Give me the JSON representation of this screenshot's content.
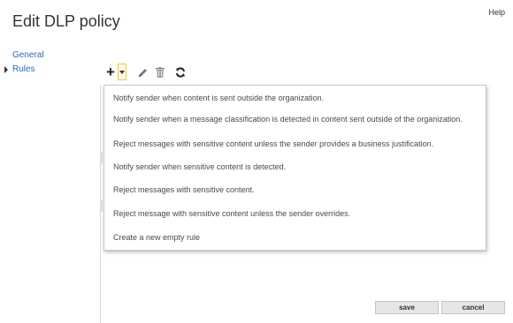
{
  "window": {
    "title": "Edit DLP policy",
    "help_label": "Help"
  },
  "nav": {
    "items": [
      {
        "label": "General"
      },
      {
        "label": "Rules"
      }
    ]
  },
  "toolbar": {
    "add_label": "+",
    "icons": [
      "add-icon",
      "dropdown-arrow-icon",
      "pencil-icon",
      "trash-icon",
      "refresh-icon"
    ]
  },
  "menu": {
    "items": [
      {
        "label": "Notify sender when content is sent outside the organization."
      },
      {
        "label": "Notify sender when a message classification is detected in content sent outside of the organization."
      },
      {
        "label": "Reject messages with sensitive content unless the sender provides a business justification."
      },
      {
        "label": "Notify sender when sensitive content is detected."
      },
      {
        "label": "Reject messages with sensitive content."
      },
      {
        "label": "Reject message with sensitive content unless the sender overrides."
      },
      {
        "label": "Create a new empty rule"
      }
    ]
  },
  "footer": {
    "save_label": "save",
    "cancel_label": "cancel"
  },
  "colors": {
    "link": "#2e6ab0",
    "highlight_border": "#f0c34a"
  }
}
